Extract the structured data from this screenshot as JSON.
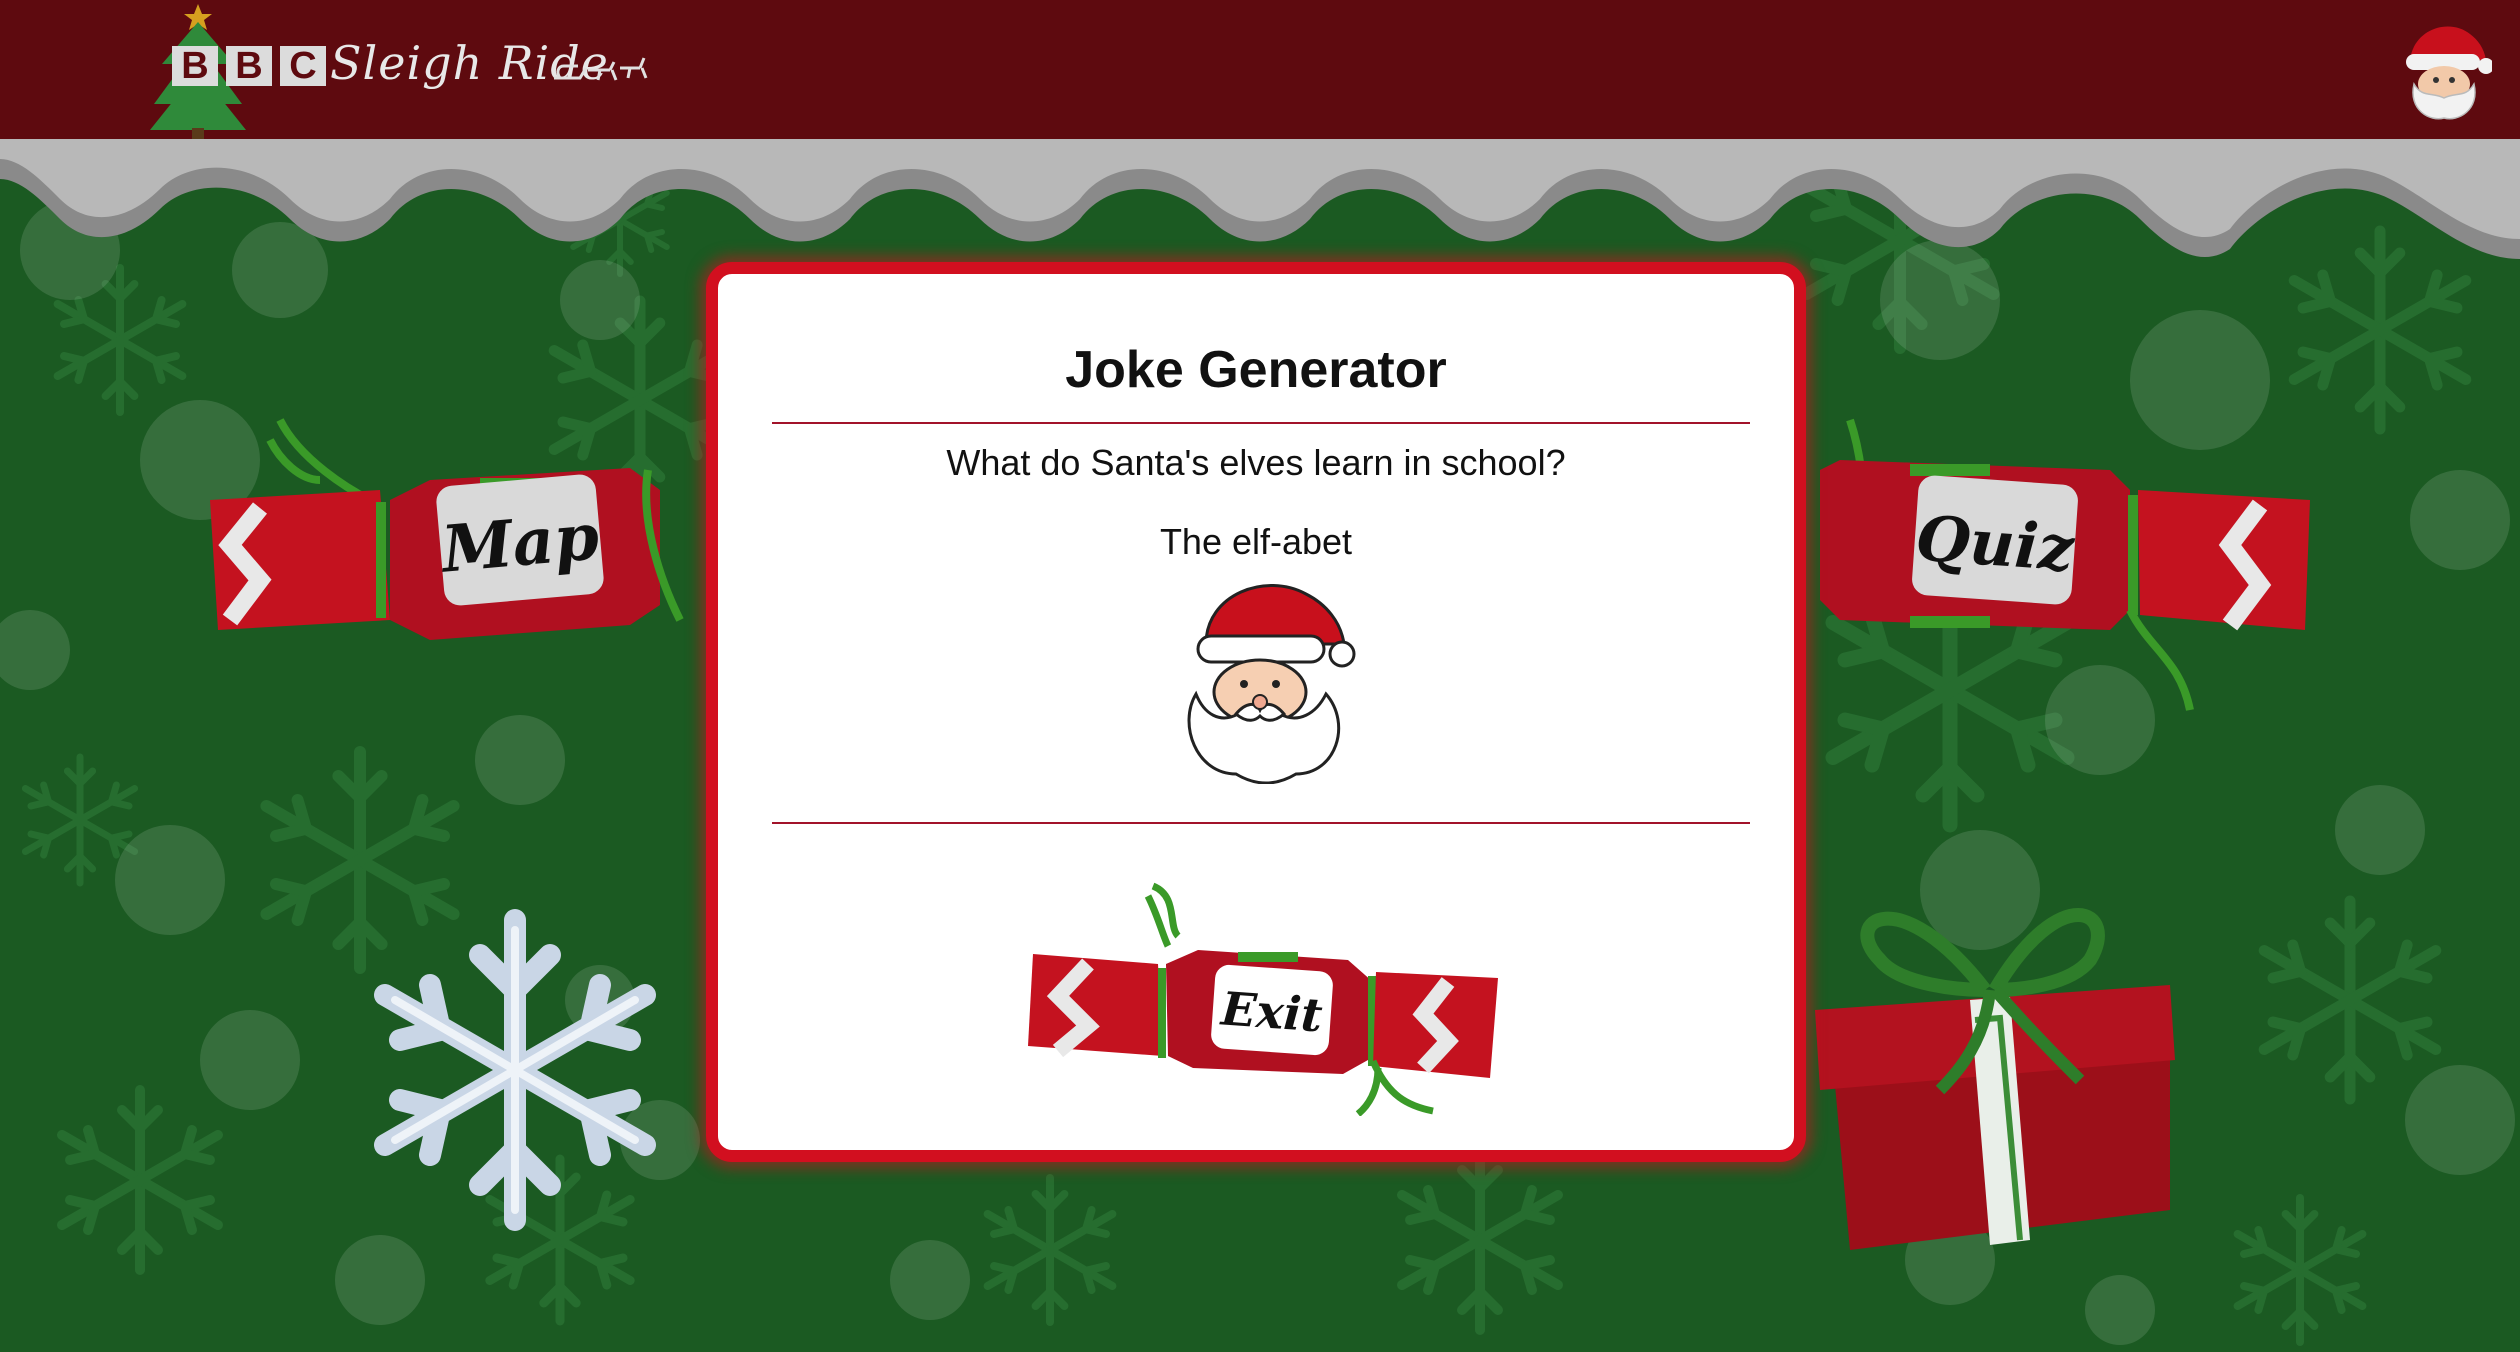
{
  "header": {
    "logo_letters": [
      "B",
      "B",
      "C"
    ],
    "logo_title": "Sleigh Ride",
    "avatar_icon": "santa-avatar-icon"
  },
  "nav": {
    "map_label": "Map",
    "quiz_label": "Quiz"
  },
  "modal": {
    "title": "Joke Generator",
    "question": "What do Santa's elves learn in school?",
    "answer": "The elf-abet",
    "image_icon": "santa-face-icon",
    "exit_label": "Exit"
  },
  "colors": {
    "header_bg": "#5e0a0f",
    "background": "#1a5c22",
    "modal_border": "#d20f1f",
    "cracker_red": "#c4121f",
    "ribbon_green": "#3a9a28"
  }
}
